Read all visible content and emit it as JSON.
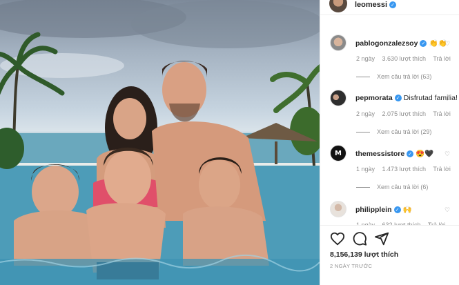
{
  "post": {
    "author": "leomessi",
    "photo_alt": "Family photo in a swimming pool"
  },
  "comments": [
    {
      "username": "pablogonzalezsoy",
      "text": "👏👏",
      "time": "2 ngày",
      "likes": "3.630 lượt thích",
      "reply": "Trả lời",
      "view_replies": "Xem câu trả lời (63)"
    },
    {
      "username": "pepmorata",
      "text": "Disfrutad familia!",
      "time": "2 ngày",
      "likes": "2.075 lượt thích",
      "reply": "Trả lời",
      "view_replies": "Xem câu trả lời (29)"
    },
    {
      "username": "themessistore",
      "text": "😍🖤",
      "time": "1 ngày",
      "likes": "1.473 lượt thích",
      "reply": "Trả lời",
      "view_replies": "Xem câu trả lời (6)"
    },
    {
      "username": "philipplein",
      "text": "🙌",
      "time": "1 ngày",
      "likes": "632 lượt thích",
      "reply": "Trả lời"
    }
  ],
  "footer": {
    "like_count": "8,156,139 lượt thích",
    "posted": "2 NGÀY TRƯỚC"
  },
  "icons": {
    "like": "heart-icon",
    "comment": "comment-icon",
    "share": "share-icon",
    "verified": "verified-badge-icon"
  },
  "colors": {
    "verified": "#3897f0",
    "muted": "#8e8e8e",
    "text": "#262626"
  }
}
